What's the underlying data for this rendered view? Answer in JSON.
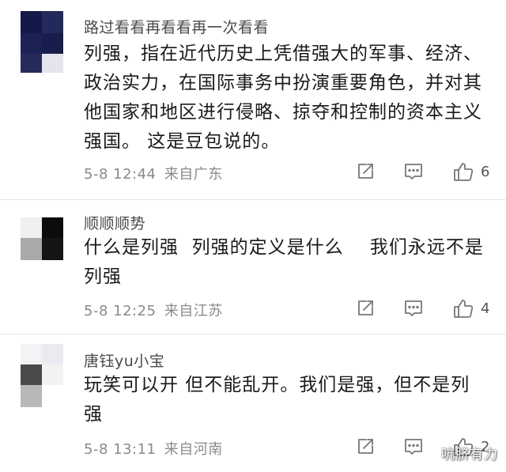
{
  "comments": [
    {
      "username": "路过看看再看看再一次看看",
      "lines": [
        "列强，指在近代历史上凭借强大的军事、经济、",
        "政治实力，在国际事务中扮演重要角色，并对其",
        "他国家和地区进行侵略、掠夺和控制的资本主义",
        "强国。 这是豆包说的。"
      ],
      "date": "5-8 12:44",
      "location": "来自广东",
      "likes": "6"
    },
    {
      "username": "顺顺顺势",
      "lines": [
        "什么是列强  列强的定义是什么    我们永远不是",
        "列强"
      ],
      "date": "5-8 12:25",
      "location": "来自江苏",
      "likes": "4"
    },
    {
      "username": "唐钰yu小宝",
      "lines": [
        "玩笑可以开 但不能乱开。我们是强，但不是列",
        "强"
      ],
      "date": "5-8 13:11",
      "location": "来自河南",
      "likes": "2"
    }
  ],
  "icons": {
    "share": "share-icon",
    "comment": "comment-icon",
    "like": "like-icon"
  },
  "watermark": "吭脐有力",
  "colors": {
    "text": "#1a1a1a",
    "username": "#4a4a4a",
    "meta": "#8a8a8a",
    "icon": "#777777",
    "divider": "#e8e8e8"
  }
}
